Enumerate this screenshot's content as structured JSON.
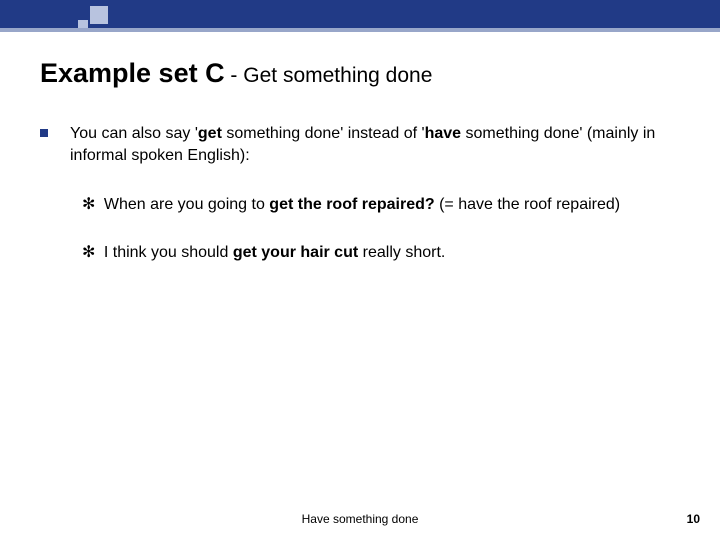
{
  "slide": {
    "heading_main": "Example set C",
    "heading_sep": " - ",
    "heading_sub": "Get something done",
    "bullet": {
      "pre": " You can also say ",
      "b1_open": "'",
      "b1_bold": "get",
      "b1_rest": " something done' instead of '",
      "b2_bold": "have",
      "b2_rest": " something done'   (mainly in informal spoken English):"
    },
    "ex1": {
      "sym": "✻",
      "pre": " When are you going to ",
      "bold": "get the roof repaired?",
      "post": " (= have the roof repaired)"
    },
    "ex2": {
      "sym": "✻",
      "pre": " I think you should ",
      "bold": "get your hair cut",
      "post": " really short."
    }
  },
  "footer": {
    "title": "Have something done",
    "page": "10"
  }
}
